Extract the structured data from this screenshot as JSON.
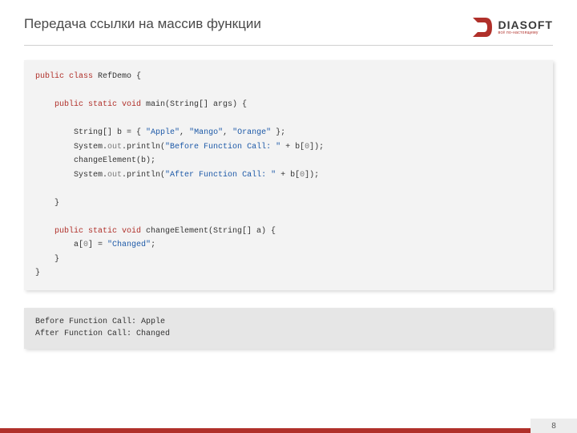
{
  "title": "Передача ссылки на массив функции",
  "logo": {
    "name": "DIASOFT",
    "tagline": "всё по-настоящему"
  },
  "code": {
    "l1a": "public class",
    "l1b": " RefDemo {",
    "l2a": "    public static void",
    "l2b": " main(String[] args) {",
    "l3a": "        String[] b = { ",
    "l3b": "\"Apple\"",
    "l3c": ", ",
    "l3d": "\"Mango\"",
    "l3e": ", ",
    "l3f": "\"Orange\"",
    "l3g": " };",
    "l4a": "        System.",
    "l4b": "out",
    "l4c": ".println(",
    "l4d": "\"Before Function Call: \"",
    "l4e": " + b[",
    "l4f": "0",
    "l4g": "]);",
    "l5": "        changeElement(b);",
    "l6a": "        System.",
    "l6b": "out",
    "l6c": ".println(",
    "l6d": "\"After Function Call: \"",
    "l6e": " + b[",
    "l6f": "0",
    "l6g": "]);",
    "l7": "    }",
    "l8a": "    public static void",
    "l8b": " changeElement(String[] a) {",
    "l9a": "        a[",
    "l9b": "0",
    "l9c": "] = ",
    "l9d": "\"Changed\"",
    "l9e": ";",
    "l10": "    }",
    "l11": "}"
  },
  "output": "Before Function Call: Apple\nAfter Function Call: Changed",
  "page_number": "8"
}
